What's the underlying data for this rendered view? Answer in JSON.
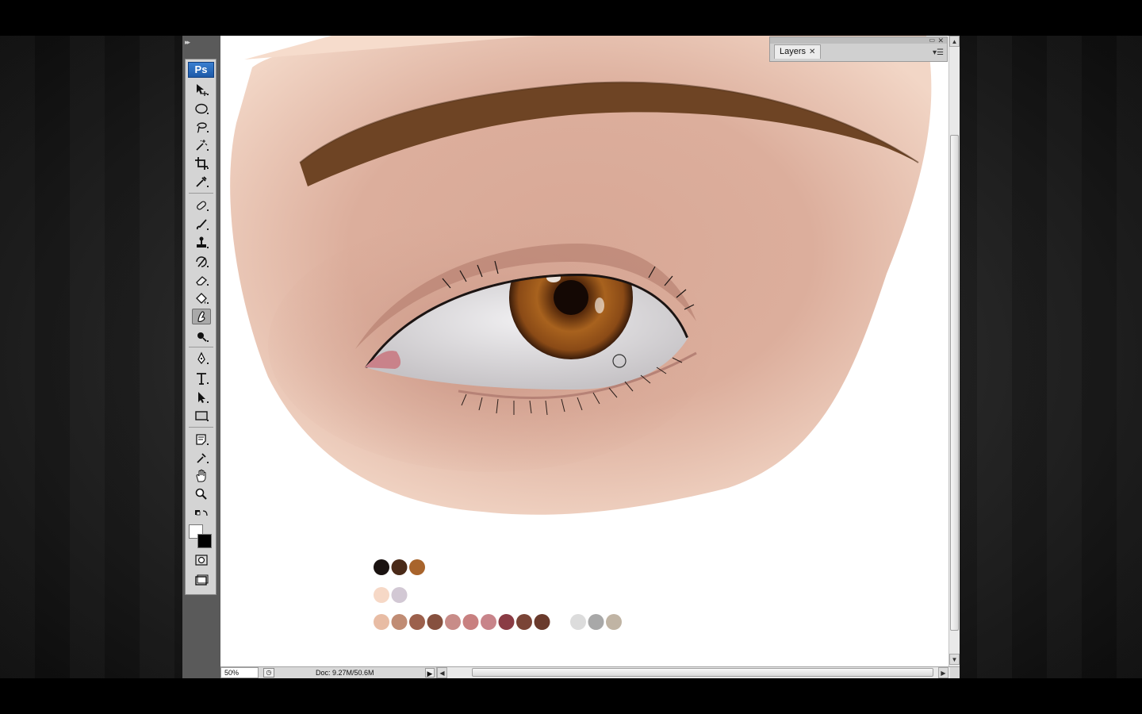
{
  "app": {
    "logo": "Ps",
    "collapse_glyph": "▸▸"
  },
  "toolbox": {
    "tools": [
      {
        "name": "move-tool",
        "icon": "move-icon"
      },
      {
        "name": "marquee-tool",
        "icon": "ellipse-marquee-icon"
      },
      {
        "name": "lasso-tool",
        "icon": "lasso-icon"
      },
      {
        "name": "magic-wand-tool",
        "icon": "magic-wand-icon"
      },
      {
        "name": "crop-tool",
        "icon": "crop-icon"
      },
      {
        "name": "eyedropper-tool",
        "icon": "eyedropper-icon"
      },
      {
        "name": "healing-brush-tool",
        "icon": "bandage-icon"
      },
      {
        "name": "brush-tool",
        "icon": "brush-icon"
      },
      {
        "name": "clone-stamp-tool",
        "icon": "stamp-icon"
      },
      {
        "name": "history-brush-tool",
        "icon": "history-brush-icon"
      },
      {
        "name": "eraser-tool",
        "icon": "eraser-icon"
      },
      {
        "name": "paint-bucket-tool",
        "icon": "bucket-icon"
      },
      {
        "name": "smudge-tool",
        "icon": "smudge-icon",
        "active": true
      },
      {
        "name": "dodge-tool",
        "icon": "dodge-icon"
      },
      {
        "name": "pen-tool",
        "icon": "pen-icon"
      },
      {
        "name": "type-tool",
        "icon": "type-icon"
      },
      {
        "name": "path-selection-tool",
        "icon": "arrow-icon"
      },
      {
        "name": "shape-tool",
        "icon": "rectangle-icon"
      },
      {
        "name": "notes-tool",
        "icon": "notes-icon"
      },
      {
        "name": "sampler-tool",
        "icon": "sampler-icon"
      },
      {
        "name": "hand-tool",
        "icon": "hand-icon"
      },
      {
        "name": "zoom-tool",
        "icon": "magnifier-icon"
      }
    ],
    "foreground_color": "#ffffff",
    "background_color": "#000000"
  },
  "layers_panel": {
    "tab_label": "Layers",
    "close_glyph": "✕",
    "menu_glyph": "▾☰"
  },
  "statusbar": {
    "zoom": "50%",
    "doc_info": "Doc: 9.27M/50.6M",
    "arrow": "▶"
  },
  "scroll": {
    "up": "▲",
    "down": "▼",
    "left": "◀",
    "right": "▶"
  },
  "palette": {
    "row1": [
      "#1a1210",
      "#4a2a18",
      "#a8642c"
    ],
    "row2": [
      "#f6d8c6",
      "#d2c8d4"
    ],
    "row3": [
      "#e8bca4",
      "#c08c74",
      "#9c604c",
      "#86503e",
      "#c88c88",
      "#c88080",
      "#c8848a",
      "#8a3c44",
      "#7a4436",
      "#6a3a2c"
    ],
    "greys": [
      "#dcdcdc",
      "#a8a8a8",
      "#c0b4a4"
    ]
  },
  "colors": {
    "skin": "#e4b8a4",
    "iris": "#9a5a20",
    "brow": "#6e4424",
    "sclera": "#e6e6e8"
  }
}
